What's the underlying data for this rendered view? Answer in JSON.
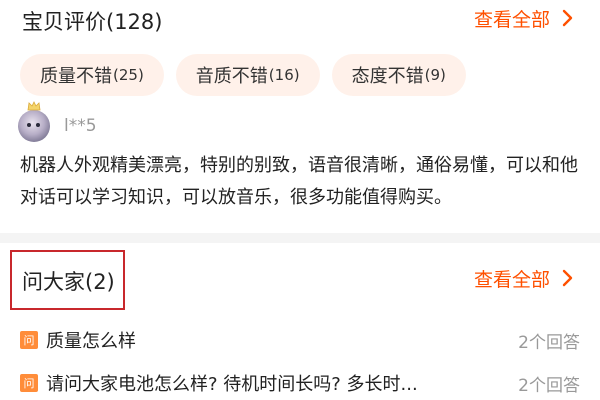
{
  "reviews": {
    "title": "宝贝评价(128)",
    "see_all": "查看全部",
    "tags": [
      {
        "label": "质量不错",
        "count": "(25)"
      },
      {
        "label": "音质不错",
        "count": "(16)"
      },
      {
        "label": "态度不错",
        "count": "(9)"
      }
    ],
    "item": {
      "username": "l**5",
      "text": "机器人外观精美漂亮，特别的别致，语音很清晰，通俗易懂，可以和他对话可以学习知识，可以放音乐，很多功能值得购买。"
    }
  },
  "qa": {
    "title": "问大家(2)",
    "see_all": "查看全部",
    "badge": "问",
    "items": [
      {
        "question": "质量怎么样",
        "answers": "2个回答"
      },
      {
        "question": "请问大家电池怎么样? 待机时间长吗? 多长时...",
        "answers": "2个回答"
      }
    ]
  },
  "colors": {
    "accent": "#ff5000",
    "tag_bg": "#fff1ea",
    "highlight_box": "#c8282c",
    "badge": "#ff8d3a"
  },
  "icons": {
    "see_all": "chevron-right-icon"
  }
}
